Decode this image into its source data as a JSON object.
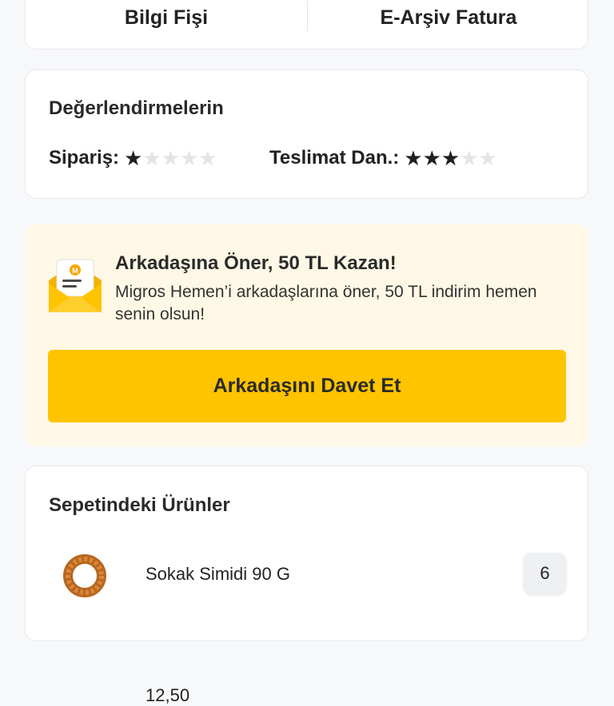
{
  "receipt": {
    "bilgi_fisi_label": "Bilgi Fişi",
    "e_arsiv_label": "E-Arşiv Fatura"
  },
  "ratings": {
    "title": "Değerlendirmelerin",
    "order_label": "Sipariş:",
    "order_stars": 1,
    "delivery_label": "Teslimat Dan.:",
    "delivery_stars": 3,
    "max_stars": 5
  },
  "referral": {
    "title": "Arkadaşına Öner, 50 TL Kazan!",
    "description": "Migros Hemen’i arkadaşlarına öner, 50 TL indirim hemen senin olsun!",
    "button_label": "Arkadaşını Davet Et",
    "icon": "envelope-icon"
  },
  "cart": {
    "title": "Sepetindeki Ürünler",
    "items": [
      {
        "name": "Sokak Simidi 90 G",
        "quantity": "6",
        "price": "12,50"
      }
    ]
  },
  "colors": {
    "accent": "#ffc400",
    "referral_bg": "#fff8e6",
    "page_bg": "#f7f8fa"
  }
}
